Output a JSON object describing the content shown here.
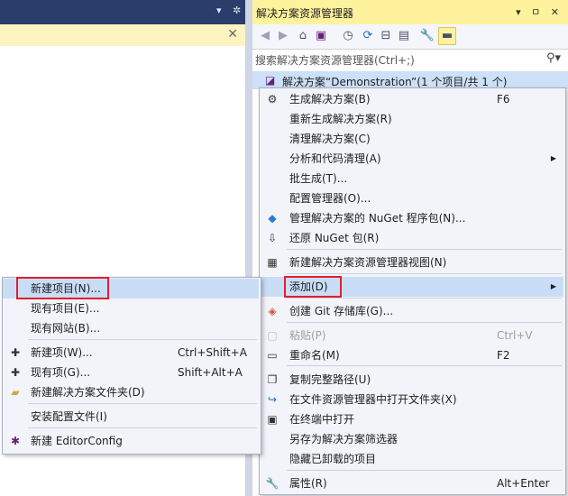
{
  "left": {
    "title_dropdown": "▾",
    "title_gear": "✲",
    "doc_close": "✕"
  },
  "solution_explorer": {
    "title": "解决方案资源管理器",
    "title_icons": {
      "dropdown": "▾",
      "pin": "ㅁ",
      "close": "✕"
    },
    "search_placeholder": "搜索解决方案资源管理器(Ctrl+;)",
    "solution_label": "解决方案“Demonstration”(1 个项目/共 1 个)"
  },
  "main_menu": {
    "items": [
      {
        "label": "生成解决方案(B)",
        "shortcut": "F6",
        "icon": "build-icon"
      },
      {
        "label": "重新生成解决方案(R)"
      },
      {
        "label": "清理解决方案(C)"
      },
      {
        "label": "分析和代码清理(A)",
        "submenu": true
      },
      {
        "label": "批生成(T)..."
      },
      {
        "label": "配置管理器(O)..."
      },
      {
        "label": "管理解决方案的 NuGet 程序包(N)...",
        "icon": "nuget-icon"
      },
      {
        "label": "还原 NuGet 包(R)",
        "icon": "restore-icon"
      },
      {
        "label": "新建解决方案资源管理器视图(N)",
        "icon": "new-view-icon"
      },
      {
        "label": "添加(D)",
        "submenu": true,
        "highlighted": true
      },
      {
        "label": "创建 Git 存储库(G)...",
        "icon": "git-icon"
      },
      {
        "label": "粘贴(P)",
        "shortcut": "Ctrl+V",
        "disabled": true,
        "icon": "paste-icon"
      },
      {
        "label": "重命名(M)",
        "shortcut": "F2",
        "icon": "rename-icon"
      },
      {
        "label": "复制完整路径(U)",
        "icon": "copy-path-icon"
      },
      {
        "label": "在文件资源管理器中打开文件夹(X)",
        "icon": "open-folder-icon"
      },
      {
        "label": "在终端中打开",
        "icon": "terminal-icon"
      },
      {
        "label": "另存为解决方案筛选器"
      },
      {
        "label": "隐藏已卸载的项目"
      },
      {
        "label": "属性(R)",
        "shortcut": "Alt+Enter",
        "icon": "wrench-icon"
      }
    ]
  },
  "add_submenu": {
    "items": [
      {
        "label": "新建项目(N)...",
        "highlighted": true
      },
      {
        "label": "现有项目(E)..."
      },
      {
        "label": "现有网站(B)..."
      },
      {
        "label": "新建项(W)...",
        "shortcut": "Ctrl+Shift+A",
        "icon": "new-item-icon"
      },
      {
        "label": "现有项(G)...",
        "shortcut": "Shift+Alt+A",
        "icon": "existing-item-icon"
      },
      {
        "label": "新建解决方案文件夹(D)",
        "icon": "solution-folder-icon"
      },
      {
        "label": "安装配置文件(I)"
      },
      {
        "label": "新建 EditorConfig",
        "icon": "editorconfig-icon"
      }
    ]
  },
  "colors": {
    "accent_yellow": "#fff29d",
    "highlight": "#c9ddf6",
    "title_dark": "#2b3d6b",
    "callout_red": "#e0202e"
  }
}
